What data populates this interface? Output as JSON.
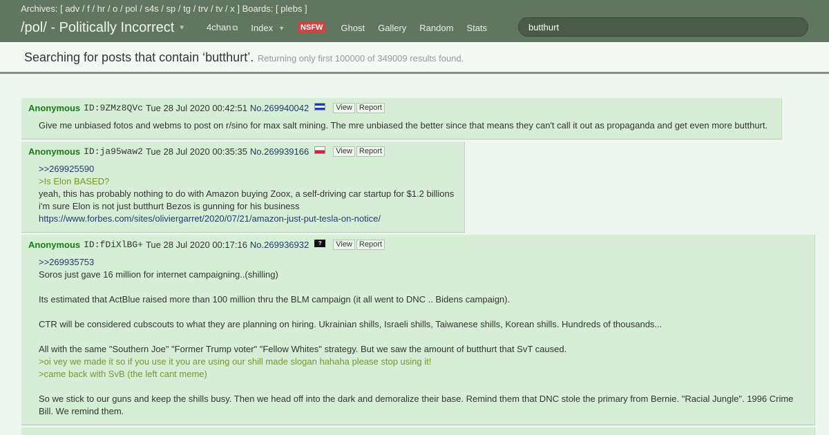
{
  "header": {
    "archives_label": "Archives: [",
    "archives": [
      "adv",
      "f",
      "hr",
      "o",
      "pol",
      "s4s",
      "sp",
      "tg",
      "trv",
      "tv",
      "x"
    ],
    "archives_close": "]",
    "boards_label": "Boards: [",
    "boards": [
      "plebs"
    ],
    "boards_close": "]",
    "board_title": "/pol/ - Politically Incorrect",
    "nav": {
      "fourchan": "4chan",
      "index": "Index",
      "nsfw": "NSFW",
      "ghost": "Ghost",
      "gallery": "Gallery",
      "random": "Random",
      "stats": "Stats"
    },
    "search_value": "butthurt"
  },
  "search_info": {
    "main": "Searching for posts that contain ‘butthurt’.",
    "sub": "Returning only first 100000 of 349009 results found."
  },
  "buttons": {
    "view": "View",
    "report": "Report"
  },
  "posts": [
    {
      "author": "Anonymous",
      "id": "ID:9ZMz8QVc",
      "date": "Tue 28 Jul 2020 00:42:51",
      "number": "No.269940042",
      "flag": "sv",
      "lines": [
        {
          "type": "text",
          "text": "Give me unbiased fotos and webms to post on r/sino for max salt mining. The mre unbiased the better since that means they can't call it out as propaganda and get even more butthurt."
        }
      ]
    },
    {
      "author": "Anonymous",
      "id": "ID:ja95waw2",
      "date": "Tue 28 Jul 2020 00:35:35",
      "number": "No.269939166",
      "flag": "pl",
      "lines": [
        {
          "type": "quotelink",
          "text": ">>269925590"
        },
        {
          "type": "greentext",
          "text": ">Is Elon BASED?"
        },
        {
          "type": "text",
          "text": "yeah, this has probably nothing to do with Amazon buying Zoox, a self-driving car startup for $1.2 billions"
        },
        {
          "type": "text",
          "text": "i'm sure Elon is not just butthurt Bezos is gunning for his business"
        },
        {
          "type": "link",
          "text": "https://www.forbes.com/sites/oliviergarret/2020/07/21/amazon-just-put-tesla-on-notice/"
        }
      ]
    },
    {
      "author": "Anonymous",
      "id": "ID:fDiXlBG+",
      "date": "Tue 28 Jul 2020 00:17:16",
      "number": "No.269936932",
      "flag": "unk",
      "lines": [
        {
          "type": "quotelink",
          "text": ">>269935753"
        },
        {
          "type": "text",
          "text": "Soros just gave 16 million for internet campaigning..(shilling)"
        },
        {
          "type": "blank",
          "text": ""
        },
        {
          "type": "text",
          "text": "Its estimated that ActBlue raised more than 100 million thru the BLM campaign (it all went to DNC .. Bidens campaign)."
        },
        {
          "type": "blank",
          "text": ""
        },
        {
          "type": "text",
          "text": "CTR will be considered cubscouts to what they are planning on hiring. Ukrainian shills, Israeli shills, Taiwanese shills, Korean shills. Hundreds of thousands..."
        },
        {
          "type": "blank",
          "text": ""
        },
        {
          "type": "text",
          "text": "All with the same \"Southern Joe\" \"Former Trump voter\" \"Fellow Whites\" strategy. But we saw the amount of butthurt that SvT caused."
        },
        {
          "type": "greentext",
          "text": ">oi vey we made it so if you use it you are using our shill made slogan hahaha please stop using it!"
        },
        {
          "type": "greentext",
          "text": ">came back with SvB (the left cant meme)"
        },
        {
          "type": "blank",
          "text": ""
        },
        {
          "type": "text",
          "text": "So we stick to our guns and keep the shills busy. Then we head off into the dark and demoralize their base. Remind them that DNC stole the primary from Bernie. \"Racial Jungle\". 1996 Crime"
        },
        {
          "type": "text",
          "text": "Bill. We remind them."
        }
      ]
    }
  ]
}
